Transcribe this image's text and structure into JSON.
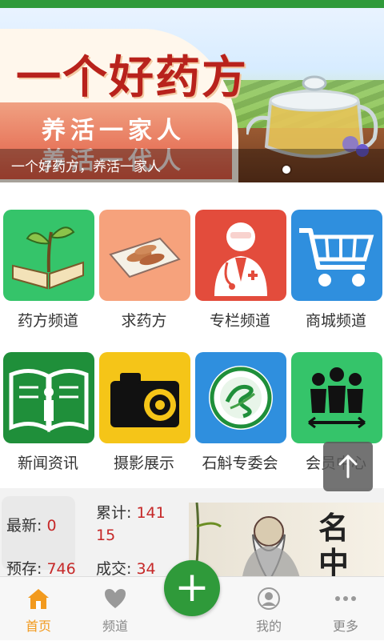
{
  "banner": {
    "title": "一个好药方",
    "slogan_line1": "养活一家人",
    "slogan_line2": "养活一代人",
    "caption": "一个好药方，养活一家人",
    "slide_indicator_active": 1
  },
  "grid": {
    "items": [
      {
        "label": "药方频道",
        "icon": "book-sprout-icon",
        "color": "#35c46a"
      },
      {
        "label": "求药方",
        "icon": "herb-slices-icon",
        "color": "#f6a27c"
      },
      {
        "label": "专栏频道",
        "icon": "doctor-icon",
        "color": "#e34c3c"
      },
      {
        "label": "商城频道",
        "icon": "shopping-cart-icon",
        "color": "#2f8fde"
      },
      {
        "label": "新闻资讯",
        "icon": "info-book-icon",
        "color": "#1f8f3a"
      },
      {
        "label": "摄影展示",
        "icon": "camera-icon",
        "color": "#f5c518"
      },
      {
        "label": "石斛专委会",
        "icon": "committee-logo-icon",
        "color": "#2f8fde"
      },
      {
        "label": "会员中心",
        "icon": "members-icon",
        "color": "#35c46a"
      }
    ]
  },
  "stats": {
    "latest_label": "最新:",
    "latest_value": "0",
    "total_label": "累计:",
    "total_value_line1": "141",
    "total_value_line2": "15",
    "reserve_label": "预存:",
    "reserve_value": "746",
    "deal_label": "成交:",
    "deal_value": "34",
    "scroll_text": "名中"
  },
  "back_to_top": {
    "icon": "arrow-up-icon"
  },
  "bottom_nav": {
    "items": [
      {
        "label": "首页",
        "icon": "home-icon",
        "active": true
      },
      {
        "label": "频道",
        "icon": "heart-icon",
        "active": false
      },
      {
        "label": "我的",
        "icon": "user-icon",
        "active": false
      },
      {
        "label": "更多",
        "icon": "more-icon",
        "active": false
      }
    ],
    "plus_label": "+",
    "active_color": "#f29a1e",
    "inactive_color": "#888888"
  }
}
